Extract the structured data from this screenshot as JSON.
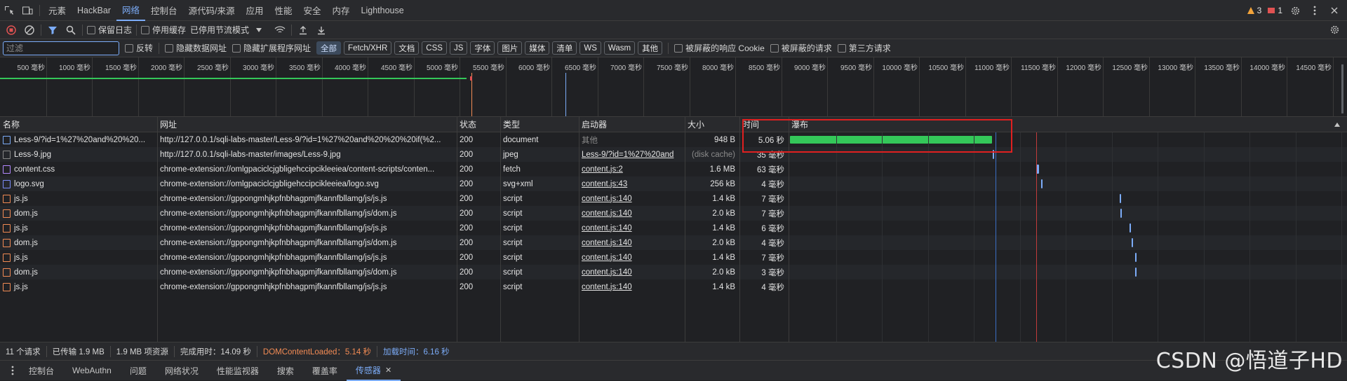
{
  "tabs": [
    "元素",
    "HackBar",
    "网络",
    "控制台",
    "源代码/来源",
    "应用",
    "性能",
    "安全",
    "内存",
    "Lighthouse"
  ],
  "active_tab": "网络",
  "tab_right": {
    "warnings": "3",
    "errors": "1"
  },
  "toolbar": {
    "preserve_log": "保留日志",
    "disable_cache": "停用缓存",
    "throttle": "已停用节流模式"
  },
  "filter": {
    "placeholder": "过滤",
    "invert": "反转",
    "hide_data_urls": "隐藏数据网址",
    "hide_ext_urls": "隐藏扩展程序网址",
    "types": [
      "全部",
      "Fetch/XHR",
      "文档",
      "CSS",
      "JS",
      "字体",
      "图片",
      "媒体",
      "清单",
      "WS",
      "Wasm",
      "其他"
    ],
    "active_type": "全部",
    "blocked_cookies": "被屏蔽的响应 Cookie",
    "blocked_requests": "被屏蔽的请求",
    "third_party": "第三方请求"
  },
  "overview_ticks": [
    "500 毫秒",
    "1000 毫秒",
    "1500 毫秒",
    "2000 毫秒",
    "2500 毫秒",
    "3000 毫秒",
    "3500 毫秒",
    "4000 毫秒",
    "4500 毫秒",
    "5000 毫秒",
    "5500 毫秒",
    "6000 毫秒",
    "6500 毫秒",
    "7000 毫秒",
    "7500 毫秒",
    "8000 毫秒",
    "8500 毫秒",
    "9000 毫秒",
    "9500 毫秒",
    "10000 毫秒",
    "10500 毫秒",
    "11000 毫秒",
    "11500 毫秒",
    "12000 毫秒",
    "12500 毫秒",
    "13000 毫秒",
    "13500 毫秒",
    "14000 毫秒",
    "14500 毫秒"
  ],
  "columns": {
    "name": "名称",
    "url": "网址",
    "status": "状态",
    "type": "类型",
    "initiator": "启动器",
    "size": "大小",
    "time": "时间",
    "waterfall": "瀑布"
  },
  "rows": [
    {
      "name": "Less-9/?id=1%27%20and%20%20...",
      "url": "http://127.0.0.1/sqli-labs-master/Less-9/?id=1%27%20and%20%20%20if(%2...",
      "status": "200",
      "type": "document",
      "initiator": "其他",
      "size": "948 B",
      "time": "5.06 秒",
      "icon": "doc-icon",
      "icon_color": "#7cacf8",
      "wf_start": 0,
      "wf_len": 5060,
      "wf_color": "#34c759"
    },
    {
      "name": "Less-9.jpg",
      "url": "http://127.0.0.1/sqli-labs-master/images/Less-9.jpg",
      "status": "200",
      "type": "jpeg",
      "initiator": "Less-9/?id=1%27%20and",
      "size": "(disk cache)",
      "time": "35 毫秒",
      "icon": "image-icon",
      "icon_color": "#888888",
      "wf_start": 5070,
      "wf_len": 35,
      "wf_color": "#7cacf8"
    },
    {
      "name": "content.css",
      "url": "chrome-extension://omlgpaciclcjgbligehccipcikleeiea/content-scripts/conten...",
      "status": "200",
      "type": "fetch",
      "initiator": "content.js:2",
      "size": "1.6 MB",
      "time": "63 毫秒",
      "icon": "css-icon",
      "icon_color": "#b388ff",
      "wf_start": 6170,
      "wf_len": 63,
      "wf_color": "#7cacf8"
    },
    {
      "name": "logo.svg",
      "url": "chrome-extension://omlgpaciclcjgbligehccipcikleeiea/logo.svg",
      "status": "200",
      "type": "svg+xml",
      "initiator": "content.js:43",
      "size": "256 kB",
      "time": "4 毫秒",
      "icon": "svg-icon",
      "icon_color": "#7c8cf8",
      "wf_start": 6290,
      "wf_len": 4,
      "wf_color": "#7cacf8"
    },
    {
      "name": "js.js",
      "url": "chrome-extension://gppongmhjkpfnbhagpmjfkannfbllamg/js/js.js",
      "status": "200",
      "type": "script",
      "initiator": "content.js:140",
      "size": "1.4 kB",
      "time": "7 毫秒",
      "icon": "script-icon",
      "icon_color": "#f28b54",
      "wf_start": 8260,
      "wf_len": 7,
      "wf_color": "#7cacf8"
    },
    {
      "name": "dom.js",
      "url": "chrome-extension://gppongmhjkpfnbhagpmjfkannfbllamg/js/dom.js",
      "status": "200",
      "type": "script",
      "initiator": "content.js:140",
      "size": "2.0 kB",
      "time": "7 毫秒",
      "icon": "script-icon",
      "icon_color": "#f28b54",
      "wf_start": 8270,
      "wf_len": 7,
      "wf_color": "#7cacf8"
    },
    {
      "name": "js.js",
      "url": "chrome-extension://gppongmhjkpfnbhagpmjfkannfbllamg/js/js.js",
      "status": "200",
      "type": "script",
      "initiator": "content.js:140",
      "size": "1.4 kB",
      "time": "6 毫秒",
      "icon": "script-icon",
      "icon_color": "#f28b54",
      "wf_start": 8500,
      "wf_len": 6,
      "wf_color": "#7cacf8"
    },
    {
      "name": "dom.js",
      "url": "chrome-extension://gppongmhjkpfnbhagpmjfkannfbllamg/js/dom.js",
      "status": "200",
      "type": "script",
      "initiator": "content.js:140",
      "size": "2.0 kB",
      "time": "4 毫秒",
      "icon": "script-icon",
      "icon_color": "#f28b54",
      "wf_start": 8560,
      "wf_len": 4,
      "wf_color": "#7cacf8"
    },
    {
      "name": "js.js",
      "url": "chrome-extension://gppongmhjkpfnbhagpmjfkannfbllamg/js/js.js",
      "status": "200",
      "type": "script",
      "initiator": "content.js:140",
      "size": "1.4 kB",
      "time": "7 毫秒",
      "icon": "script-icon",
      "icon_color": "#f28b54",
      "wf_start": 8640,
      "wf_len": 7,
      "wf_color": "#7cacf8"
    },
    {
      "name": "dom.js",
      "url": "chrome-extension://gppongmhjkpfnbhagpmjfkannfbllamg/js/dom.js",
      "status": "200",
      "type": "script",
      "initiator": "content.js:140",
      "size": "2.0 kB",
      "time": "3 毫秒",
      "icon": "script-icon",
      "icon_color": "#f28b54",
      "wf_start": 8650,
      "wf_len": 3,
      "wf_color": "#7cacf8"
    },
    {
      "name": "js.js",
      "url": "chrome-extension://gppongmhjkpfnbhagpmjfkannfbllamg/js/js.js",
      "status": "200",
      "type": "script",
      "initiator": "content.js:140",
      "size": "1.4 kB",
      "time": "4 毫秒",
      "icon": "script-icon",
      "icon_color": "#f28b54",
      "wf_start": 0,
      "wf_len": 0,
      "wf_color": "#7cacf8"
    }
  ],
  "status": {
    "requests": "11 个请求",
    "transferred": "已传输 1.9 MB",
    "resources": "1.9 MB 项资源",
    "finish": "完成用时：14.09 秒",
    "dcl": "DOMContentLoaded：5.14 秒",
    "load": "加载时间：6.16 秒"
  },
  "drawer_tabs": [
    "控制台",
    "WebAuthn",
    "问题",
    "网络状况",
    "性能监视器",
    "搜索",
    "覆盖率",
    "传感器"
  ],
  "drawer_active": "传感器",
  "watermark": "CSDN @悟道子HD",
  "colors": {
    "accent": "#7cacf8",
    "bg": "#202124",
    "panel": "#292a2d",
    "dcl": "#7cacf8",
    "load": "#e05252",
    "highlight": "#e02020"
  }
}
